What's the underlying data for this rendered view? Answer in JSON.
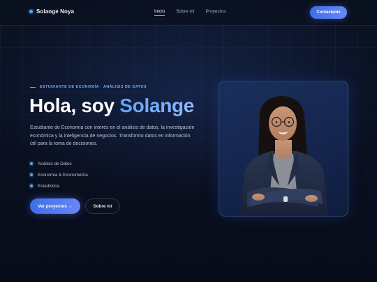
{
  "nav": {
    "brand": "Solange Noya",
    "links": [
      {
        "label": "Inicio",
        "active": true
      },
      {
        "label": "Sobre mí",
        "active": false
      },
      {
        "label": "Proyectos",
        "active": false
      }
    ],
    "cta_label": "Contáctame"
  },
  "hero": {
    "eyebrow": "ESTUDIANTE DE ECONOMÍA · ANÁLISIS DE DATOS",
    "title_prefix": "Hola, soy ",
    "title_name": "Solange",
    "description": "Estudiante de Economía con interés en el análisis de datos, la investigación económica y la inteligencia de negocios. Transformo datos en información útil para la toma de decisiones.",
    "skills": [
      "Análisis de Datos",
      "Economía & Econometría",
      "Estadística"
    ],
    "primary_button": "Ver proyectos →",
    "secondary_button": "Sobre mí"
  },
  "colors": {
    "background": "#0a0f1e",
    "accent": "#5fa5f5",
    "button_gradient_start": "#3d6fe8",
    "button_gradient_end": "#6a86f6"
  },
  "icons": {
    "brand": "dot-icon",
    "skill_bullet": "dot-icon"
  }
}
